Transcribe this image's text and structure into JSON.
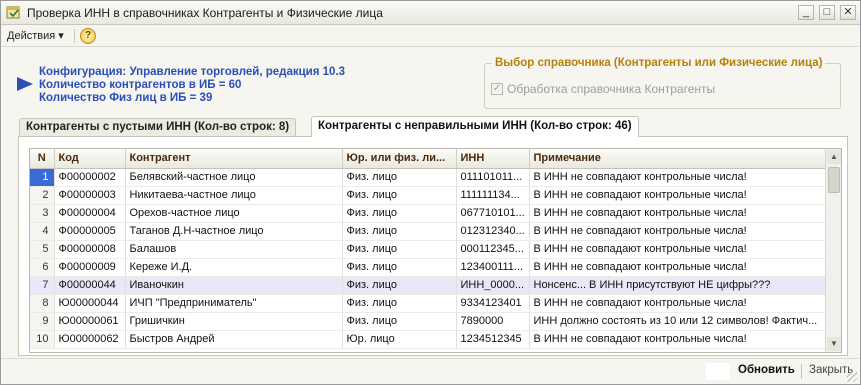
{
  "window": {
    "title": "Проверка ИНН в справочниках Контрагенты и Физические лица",
    "icon": "app-window-icon",
    "controls": {
      "minimize": "_",
      "maximize": "□",
      "close": "✕"
    }
  },
  "toolbar": {
    "actions_label": "Действия ▾",
    "help_label": "?"
  },
  "info": {
    "config": "Конфигурация: Управление торговлей, редакция 10.3",
    "contractors_count": "Количество контрагентов в ИБ = 60",
    "persons_count": "Количество Физ лиц в ИБ = 39"
  },
  "directory_choice": {
    "title": "Выбор справочника (Контрагенты или Физические лица)",
    "checkbox_label": "Обработка справочника Контрагенты",
    "checked": true,
    "enabled": false
  },
  "tabs": [
    {
      "label": "Контрагенты с пустыми ИНН (Кол-во строк: 8)",
      "active": false
    },
    {
      "label": "Контрагенты с неправильными ИНН (Кол-во строк: 46)",
      "active": true
    }
  ],
  "table": {
    "columns": [
      "N",
      "Код",
      "Контрагент",
      "Юр. или физ. ли...",
      "ИНН",
      "Примечание"
    ],
    "rows": [
      [
        "1",
        "Ф00000002",
        "Белявский-частное лицо",
        "Физ. лицо",
        "011101011...",
        "В ИНН не совпадают контрольные числа!"
      ],
      [
        "2",
        "Ф00000003",
        "Никитаева-частное лицо",
        "Физ. лицо",
        "111111134...",
        "В ИНН не совпадают контрольные числа!"
      ],
      [
        "3",
        "Ф00000004",
        "Орехов-частное лицо",
        "Физ. лицо",
        "067710101...",
        "В ИНН не совпадают контрольные числа!"
      ],
      [
        "4",
        "Ф00000005",
        "Таганов Д.Н-частное лицо",
        "Физ. лицо",
        "012312340...",
        "В ИНН не совпадают контрольные числа!"
      ],
      [
        "5",
        "Ф00000008",
        "Балашов",
        "Физ. лицо",
        "000112345...",
        "В ИНН не совпадают контрольные числа!"
      ],
      [
        "6",
        "Ф00000009",
        "Кереже И.Д.",
        "Физ. лицо",
        "123400111...",
        "В ИНН не совпадают контрольные числа!"
      ],
      [
        "7",
        "Ф00000044",
        "Иваночкин",
        "Физ. лицо",
        "ИНН_0000...",
        "Нонсенс... В ИНН присутствуют НЕ цифры???"
      ],
      [
        "8",
        "Ю00000044",
        "ИЧП \"Предприниматель\"",
        "Физ. лицо",
        "9334123401",
        "В ИНН не совпадают контрольные числа!"
      ],
      [
        "9",
        "Ю00000061",
        "Гришичкин",
        "Физ. лицо",
        "7890000",
        "ИНН должно состоять из 10 или 12 символов! Фактич..."
      ],
      [
        "10",
        "Ю00000062",
        "Быстров Андрей",
        "Юр. лицо",
        "1234512345",
        "В ИНН не совпадают контрольные числа!"
      ]
    ],
    "selected_row": 0,
    "highlighted_row": 6
  },
  "buttons": {
    "refresh": "Обновить",
    "close": "Закрыть"
  }
}
